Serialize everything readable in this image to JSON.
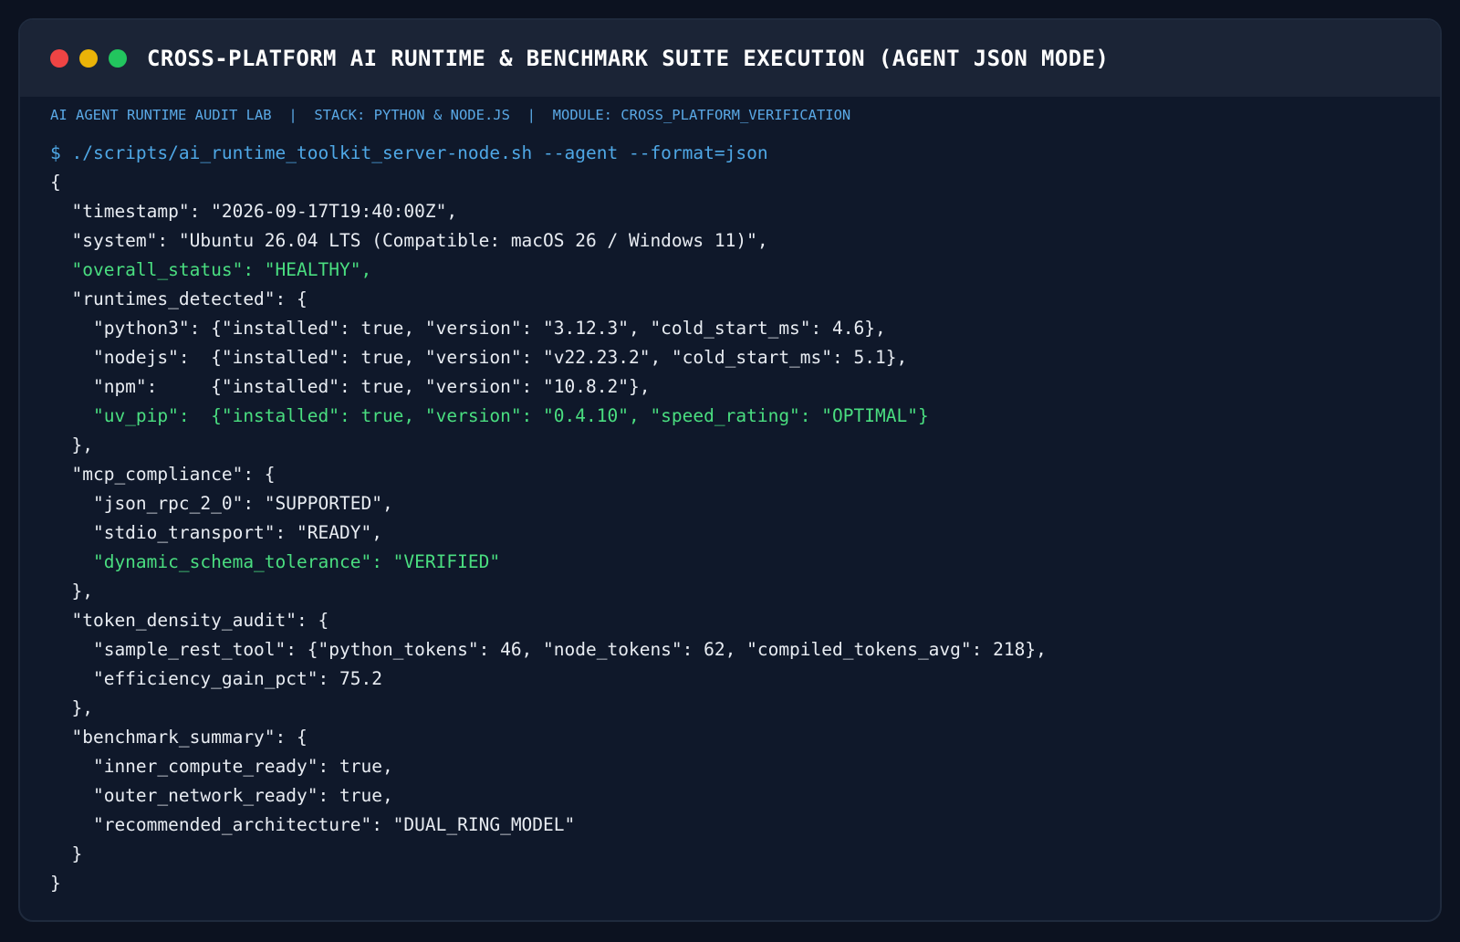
{
  "window": {
    "title": "CROSS-PLATFORM AI RUNTIME & BENCHMARK SUITE EXECUTION (AGENT JSON MODE)",
    "traffic_lights": [
      "close",
      "minimize",
      "maximize"
    ]
  },
  "subheader": {
    "lab": "AI AGENT RUNTIME AUDIT LAB",
    "separator": "|",
    "stack": "STACK: PYTHON & NODE.JS",
    "module": "MODULE: CROSS_PLATFORM_VERIFICATION"
  },
  "terminal": {
    "command": "$ ./scripts/ai_runtime_toolkit_server-node.sh --agent --format=json",
    "output_lines": [
      {
        "text": "{",
        "status": "normal"
      },
      {
        "text": "  \"timestamp\": \"2026-09-17T19:40:00Z\",",
        "status": "normal"
      },
      {
        "text": "  \"system\": \"Ubuntu 26.04 LTS (Compatible: macOS 26 / Windows 11)\",",
        "status": "normal"
      },
      {
        "text": "  \"overall_status\": \"HEALTHY\",",
        "status": "ok"
      },
      {
        "text": "  \"runtimes_detected\": {",
        "status": "normal"
      },
      {
        "text": "    \"python3\": {\"installed\": true, \"version\": \"3.12.3\", \"cold_start_ms\": 4.6},",
        "status": "normal"
      },
      {
        "text": "    \"nodejs\":  {\"installed\": true, \"version\": \"v22.23.2\", \"cold_start_ms\": 5.1},",
        "status": "normal"
      },
      {
        "text": "    \"npm\":     {\"installed\": true, \"version\": \"10.8.2\"},",
        "status": "normal"
      },
      {
        "text": "    \"uv_pip\":  {\"installed\": true, \"version\": \"0.4.10\", \"speed_rating\": \"OPTIMAL\"}",
        "status": "ok"
      },
      {
        "text": "  },",
        "status": "normal"
      },
      {
        "text": "  \"mcp_compliance\": {",
        "status": "normal"
      },
      {
        "text": "    \"json_rpc_2_0\": \"SUPPORTED\",",
        "status": "normal"
      },
      {
        "text": "    \"stdio_transport\": \"READY\",",
        "status": "normal"
      },
      {
        "text": "    \"dynamic_schema_tolerance\": \"VERIFIED\"",
        "status": "ok"
      },
      {
        "text": "  },",
        "status": "normal"
      },
      {
        "text": "  \"token_density_audit\": {",
        "status": "normal"
      },
      {
        "text": "    \"sample_rest_tool\": {\"python_tokens\": 46, \"node_tokens\": 62, \"compiled_tokens_avg\": 218},",
        "status": "normal"
      },
      {
        "text": "    \"efficiency_gain_pct\": 75.2",
        "status": "normal"
      },
      {
        "text": "  },",
        "status": "normal"
      },
      {
        "text": "  \"benchmark_summary\": {",
        "status": "normal"
      },
      {
        "text": "    \"inner_compute_ready\": true,",
        "status": "normal"
      },
      {
        "text": "    \"outer_network_ready\": true,",
        "status": "normal"
      },
      {
        "text": "    \"recommended_architecture\": \"DUAL_RING_MODEL\"",
        "status": "normal"
      },
      {
        "text": "  }",
        "status": "normal"
      },
      {
        "text": "}",
        "status": "normal"
      }
    ]
  },
  "colors": {
    "background": "#0c1220",
    "terminal_bg": "#0f182a",
    "titlebar_bg": "#1b2436",
    "text": "#e8ecf2",
    "accent_blue": "#4fa8e6",
    "ok_green": "#4ade80",
    "close_red": "#ef4444",
    "minimize_yellow": "#eab308",
    "maximize_green": "#22c55e"
  }
}
